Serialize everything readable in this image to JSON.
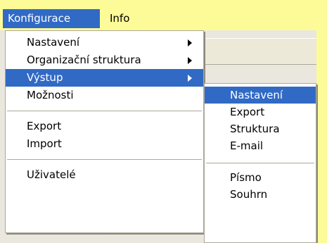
{
  "menubar": {
    "items": [
      {
        "label": "Konfigurace",
        "active": true
      },
      {
        "label": "Info",
        "active": false
      }
    ]
  },
  "main_menu": {
    "items": [
      {
        "label": "Nastavení",
        "has_submenu": true
      },
      {
        "label": "Organizační struktura",
        "has_submenu": true
      },
      {
        "label": "Výstup",
        "has_submenu": true,
        "selected": true
      },
      {
        "label": "Možnosti",
        "has_submenu": false
      },
      {
        "label": "Export",
        "has_submenu": false
      },
      {
        "label": "Import",
        "has_submenu": false
      },
      {
        "label": "Uživatelé",
        "has_submenu": false
      }
    ]
  },
  "sub_menu": {
    "items": [
      {
        "label": "Nastavení",
        "selected": true
      },
      {
        "label": "Export"
      },
      {
        "label": "Struktura"
      },
      {
        "label": "E-mail"
      },
      {
        "label": "Písmo"
      },
      {
        "label": "Souhrn"
      }
    ]
  },
  "icons": {
    "submenu_arrow": "chevron-right-icon"
  },
  "colors": {
    "background": "#fdfb97",
    "highlight": "#316ac5",
    "highlight_text": "#ffffff",
    "menu_background": "#ffffff",
    "separator": "#aca899"
  }
}
